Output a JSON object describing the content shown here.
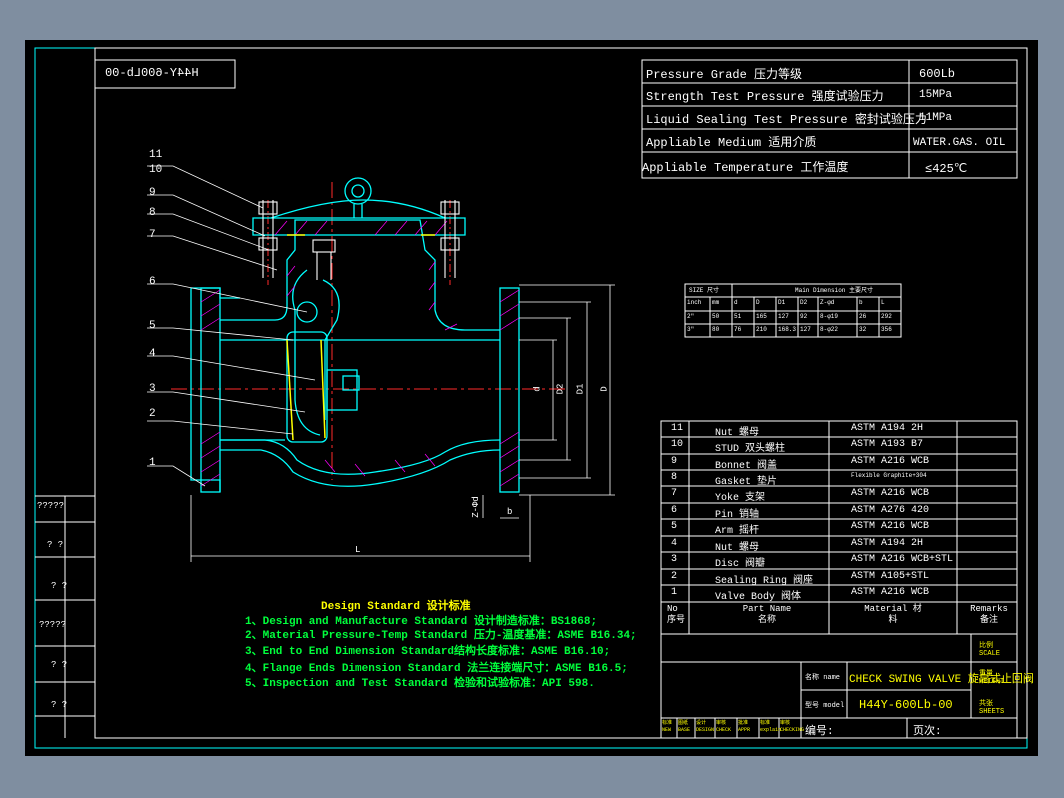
{
  "drawing_code_mirrored": "H44Y-600Lb-00",
  "specs": [
    {
      "label": "Pressure Grade 压力等级",
      "value": "600Lb"
    },
    {
      "label": "Strength Test Pressure 强度试验压力",
      "value": "15MPa"
    },
    {
      "label": "Liquid Sealing Test Pressure 密封试验压力",
      "value": "11MPa"
    },
    {
      "label": "Appliable Medium 适用介质",
      "value": "WATER.GAS. OIL"
    },
    {
      "label": "Appliable Temperature 工作温度",
      "value": "≤425℃"
    }
  ],
  "part_callouts": [
    "1",
    "2",
    "3",
    "4",
    "5",
    "6",
    "7",
    "8",
    "9",
    "10",
    "11"
  ],
  "dimension_labels": {
    "d": "d",
    "D2": "D2",
    "D1": "D1",
    "D": "D",
    "b": "b",
    "L": "L",
    "zphi": "Z-Φd"
  },
  "dim_table": {
    "title_left": "SIZE 尺寸",
    "title_right": "Main Dimension 主要尺寸",
    "headers": [
      "inch",
      "mm",
      "d",
      "D",
      "D1",
      "D2",
      "Z-φd",
      "b",
      "L"
    ],
    "rows": [
      [
        "2\"",
        "50",
        "51",
        "165",
        "127",
        "92",
        "8-φ19",
        "26",
        "292"
      ],
      [
        "3\"",
        "80",
        "76",
        "210",
        "168.3",
        "127",
        "8-φ22",
        "32",
        "356"
      ]
    ]
  },
  "parts": [
    {
      "no": "11",
      "name": "Nut 螺母",
      "material": "ASTM A194 2H"
    },
    {
      "no": "10",
      "name": "STUD 双头螺柱",
      "material": "ASTM A193 B7"
    },
    {
      "no": "9",
      "name": "Bonnet 阀盖",
      "material": "ASTM A216 WCB"
    },
    {
      "no": "8",
      "name": "Gasket 垫片",
      "material": "Flexible Graphite+304"
    },
    {
      "no": "7",
      "name": "Yoke 支架",
      "material": "ASTM A216 WCB"
    },
    {
      "no": "6",
      "name": "Pin 销轴",
      "material": "ASTM A276 420"
    },
    {
      "no": "5",
      "name": "Arm 摇杆",
      "material": "ASTM A216 WCB"
    },
    {
      "no": "4",
      "name": "Nut 螺母",
      "material": "ASTM A194 2H"
    },
    {
      "no": "3",
      "name": "Disc 阀瓣",
      "material": "ASTM A216 WCB+STL"
    },
    {
      "no": "2",
      "name": "Sealing Ring 阀座",
      "material": "ASTM A105+STL"
    },
    {
      "no": "1",
      "name": "Valve Body 阀体",
      "material": "ASTM A216 WCB"
    }
  ],
  "parts_header": {
    "no": "No 序号",
    "name": "Part Name 名称",
    "material": "Material 材料",
    "remarks": "Remarks 备注"
  },
  "title_block": {
    "name_label": "名称 name",
    "name_value": "CHECK SWING VALVE 旋启式止回阀",
    "model_label": "型号 model",
    "model_value": "H44Y-600Lb-00",
    "scale_label": "比例 SCALE",
    "weight_label": "重量 WEIGHT",
    "sheets_label": "共张 SHEETS",
    "number_label": "编号:",
    "total_label": "页次:",
    "sign_row": [
      "标准 NEW",
      "图纸 BASE",
      "设计 DESIGN",
      "审核 CHECK",
      "批准 APPR",
      "标准 explain",
      "审核 CHECKING"
    ]
  },
  "left_strip": [
    "?????",
    "? ?",
    "? ?",
    "?????",
    "? ?",
    "? ?"
  ],
  "standards": {
    "title": "Design Standard 设计标准",
    "items": [
      "1、Design and Manufacture Standard 设计制造标准：BS1868;",
      "2、Material Pressure-Temp Standard 压力-温度基准：ASME B16.34;",
      "3、End to End Dimension Standard结构长度标准：ASME B16.10;",
      "4、Flange Ends Dimension Standard 法兰连接端尺寸：ASME B16.5;",
      "5、Inspection and Test Standard 检验和试验标准：API 598."
    ]
  },
  "colors": {
    "frame": "#00ffff",
    "line": "#ffffff",
    "body": "#00ffff",
    "hatch": "#ff00ff",
    "text_y": "#ffff00",
    "text_g": "#00ff3c"
  }
}
